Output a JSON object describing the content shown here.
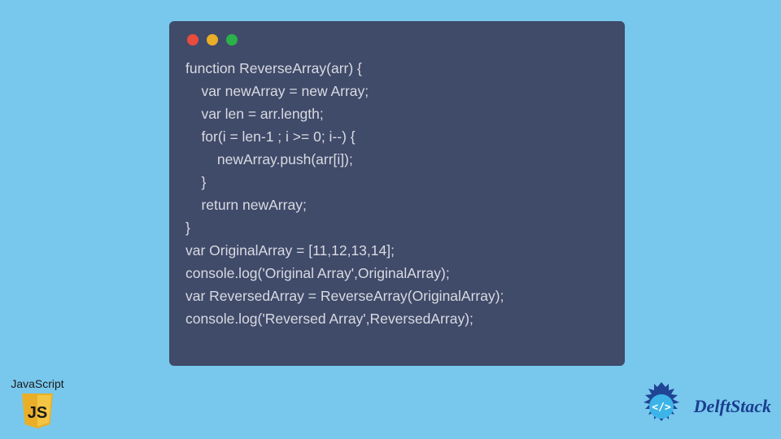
{
  "code_window": {
    "dots": [
      "red",
      "yellow",
      "green"
    ],
    "lines": [
      "function ReverseArray(arr) {",
      "    var newArray = new Array;",
      "    var len = arr.length;",
      "    for(i = len-1 ; i >= 0; i--) {",
      "        newArray.push(arr[i]);",
      "    }",
      "    return newArray;",
      "}",
      "var OriginalArray = [11,12,13,14];",
      "console.log('Original Array',OriginalArray);",
      "var ReversedArray = ReverseArray(OriginalArray);",
      "console.log('Reversed Array',ReversedArray);"
    ]
  },
  "js_badge": {
    "label": "JavaScript",
    "icon_text": "JS"
  },
  "delftstack": {
    "brand": "DelftStack"
  },
  "colors": {
    "page_bg": "#78c8ed",
    "window_bg": "#404a69",
    "code_fg": "#d8dbe2",
    "dot_red": "#e84c3d",
    "dot_yellow": "#e9af29",
    "dot_green": "#2cb14a",
    "js_shield": "#e9af29",
    "ds_blue": "#1a3d8f"
  }
}
